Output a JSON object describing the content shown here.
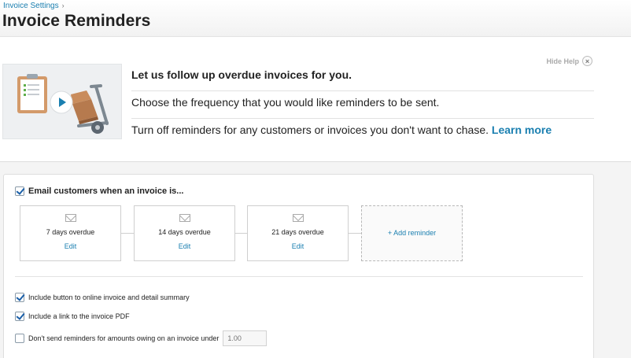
{
  "header": {
    "breadcrumb": "Invoice Settings",
    "breadcrumb_sep": "›",
    "title": "Invoice Reminders"
  },
  "help": {
    "hide_label": "Hide Help",
    "close_glyph": "×",
    "line1": "Let us follow up overdue invoices for you.",
    "line2": "Choose the frequency that you would like reminders to be sent.",
    "line3": "Turn off reminders for any customers or invoices you don't want to chase.",
    "learn_more": "Learn more"
  },
  "settings": {
    "email_customers_label": "Email customers when an invoice is...",
    "email_customers_checked": true,
    "reminders": [
      {
        "label": "7 days overdue",
        "edit": "Edit"
      },
      {
        "label": "14 days overdue",
        "edit": "Edit"
      },
      {
        "label": "21 days overdue",
        "edit": "Edit"
      }
    ],
    "add_reminder": "+ Add reminder",
    "options": [
      {
        "label": "Include button to online invoice and detail summary",
        "checked": true
      },
      {
        "label": "Include a link to the invoice PDF",
        "checked": true
      },
      {
        "label": "Don't send reminders for amounts owing on an invoice under",
        "checked": false
      }
    ],
    "min_amount_placeholder": "1.00"
  },
  "icons": {
    "video": "clipboard-and-delivery-trolley-video-icon",
    "play": "play-icon",
    "envelope": "envelope-icon"
  },
  "colors": {
    "link": "#1a7fb0",
    "checkbox": "#1a5fa8",
    "page_bg": "#f4f4f4"
  }
}
